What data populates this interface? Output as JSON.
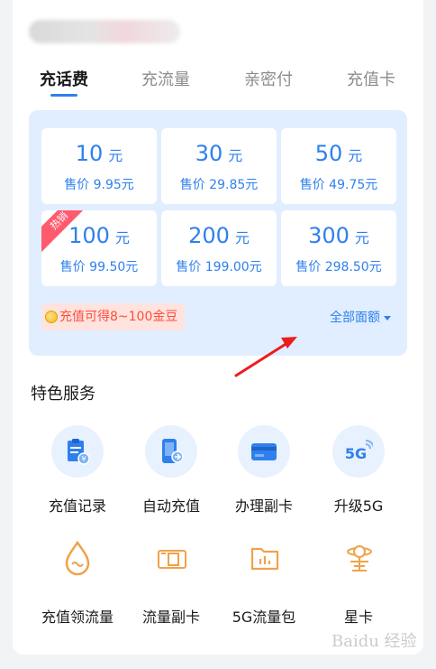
{
  "tabs": [
    {
      "label": "充话费",
      "active": true
    },
    {
      "label": "充流量",
      "active": false
    },
    {
      "label": "亲密付",
      "active": false
    },
    {
      "label": "充值卡",
      "active": false
    }
  ],
  "amounts": [
    {
      "value": "10",
      "unit": "元",
      "price": "售价 9.95元",
      "hot": false
    },
    {
      "value": "30",
      "unit": "元",
      "price": "售价 29.85元",
      "hot": false
    },
    {
      "value": "50",
      "unit": "元",
      "price": "售价 49.75元",
      "hot": false
    },
    {
      "value": "100",
      "unit": "元",
      "price": "售价 99.50元",
      "hot": true,
      "badge": "热销"
    },
    {
      "value": "200",
      "unit": "元",
      "price": "售价 199.00元",
      "hot": false
    },
    {
      "value": "300",
      "unit": "元",
      "price": "售价 298.50元",
      "hot": false
    }
  ],
  "bonus": {
    "text": "充值可得8~100金豆"
  },
  "all_amounts": {
    "label": "全部面额"
  },
  "section": {
    "title": "特色服务"
  },
  "services": [
    {
      "label": "充值记录",
      "icon": "recharge-record-icon"
    },
    {
      "label": "自动充值",
      "icon": "auto-recharge-icon"
    },
    {
      "label": "办理副卡",
      "icon": "card-icon"
    },
    {
      "label": "升级5G",
      "icon": "5g-icon",
      "icon_text": "5G"
    },
    {
      "label": "充值领流量",
      "icon": "water-drop-icon"
    },
    {
      "label": "流量副卡",
      "icon": "sim-card-icon"
    },
    {
      "label": "5G流量包",
      "icon": "folder-chart-icon"
    },
    {
      "label": "星卡",
      "icon": "star-card-icon"
    }
  ],
  "watermark": {
    "text": "Baidu 经验"
  },
  "colors": {
    "accent": "#2f80ed",
    "panel": "#e1eeff",
    "hot": "#ff5b6e",
    "bonus": "#ff4d3a",
    "icon_orange": "#f0a24a"
  }
}
